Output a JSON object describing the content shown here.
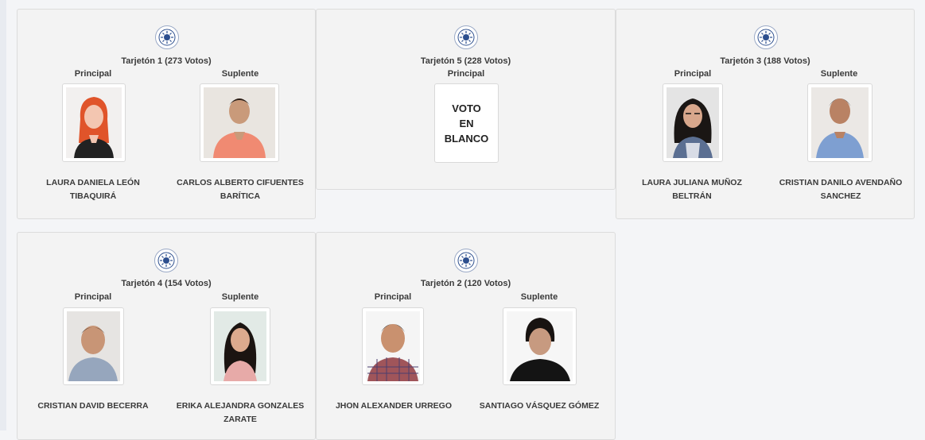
{
  "cards": [
    {
      "title": "Tarjetón 1 (273 Votos)",
      "principal_label": "Principal",
      "suplente_label": "Suplente",
      "principal_name": [
        "LAURA DANIELA LEÓN",
        "TIBAQUIRÁ"
      ],
      "suplente_name": [
        "CARLOS ALBERTO CIFUENTES",
        "BARÍTICA"
      ]
    },
    {
      "title": "Tarjetón 5 (228 Votos)",
      "principal_label": "Principal",
      "blank_vote": [
        "VOTO",
        "EN",
        "BLANCO"
      ]
    },
    {
      "title": "Tarjetón 3 (188 Votos)",
      "principal_label": "Principal",
      "suplente_label": "Suplente",
      "principal_name": [
        "LAURA JULIANA MUÑOZ",
        "BELTRÁN"
      ],
      "suplente_name": [
        "CRISTIAN DANILO AVENDAÑO",
        "SANCHEZ"
      ]
    },
    {
      "title": "Tarjetón 4 (154 Votos)",
      "principal_label": "Principal",
      "suplente_label": "Suplente",
      "principal_name": [
        "CRISTIAN DAVID BECERRA"
      ],
      "suplente_name": [
        "ERIKA ALEJANDRA GONZALES",
        "ZARATE"
      ]
    },
    {
      "title": "Tarjetón 2 (120 Votos)",
      "principal_label": "Principal",
      "suplente_label": "Suplente",
      "principal_name": [
        "JHON ALEXANDER URREGO"
      ],
      "suplente_name": [
        "SANTIAGO VÁSQUEZ GÓMEZ"
      ]
    }
  ],
  "colors": {
    "card_bg": "#f3f3f3",
    "border": "#dcdcdc",
    "logo_blue": "#2d4f8e"
  }
}
